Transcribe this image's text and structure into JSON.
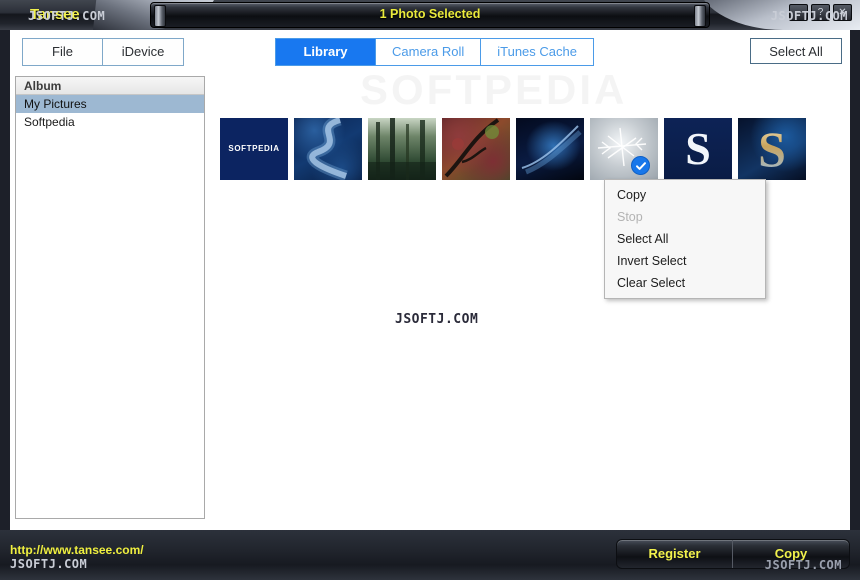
{
  "window": {
    "logo_text": "Tansee",
    "title": "1 Photo Selected",
    "controls": [
      {
        "name": "minimize",
        "glyph": "–"
      },
      {
        "name": "help",
        "glyph": "?"
      },
      {
        "name": "close",
        "glyph": "✕"
      }
    ]
  },
  "watermarks": {
    "top_left": "JSOFTJ.COM",
    "top_right": "JSOFTJ.COM",
    "center": "JSOFTJ.COM",
    "bottom_left": "JSOFTJ.COM",
    "bottom_right": "JSOFTJ.COM",
    "softpedia": "SOFTPEDIA"
  },
  "toolbar": {
    "menu_buttons": [
      {
        "label": "File"
      },
      {
        "label": "iDevice"
      }
    ],
    "tabs": [
      {
        "label": "Library",
        "active": true
      },
      {
        "label": "Camera Roll",
        "active": false
      },
      {
        "label": "iTunes Cache",
        "active": false
      }
    ],
    "select_all_label": "Select All"
  },
  "sidebar": {
    "header": "Album",
    "items": [
      {
        "label": "My Pictures",
        "selected": true
      },
      {
        "label": "Softpedia",
        "selected": false
      }
    ]
  },
  "gallery": {
    "thumbnails": [
      {
        "name": "softpedia-logo",
        "selected": false,
        "caption": "SOFTPEDIA"
      },
      {
        "name": "blue-river-s",
        "selected": false,
        "caption": ""
      },
      {
        "name": "misty-forest",
        "selected": false,
        "caption": ""
      },
      {
        "name": "autumn-leaves",
        "selected": false,
        "caption": ""
      },
      {
        "name": "blue-abstract",
        "selected": false,
        "caption": ""
      },
      {
        "name": "frost-crystal",
        "selected": true,
        "caption": ""
      },
      {
        "name": "letter-s-navy",
        "selected": false,
        "caption": "S"
      },
      {
        "name": "letter-s-gold",
        "selected": false,
        "caption": "S"
      }
    ]
  },
  "context_menu": {
    "items": [
      {
        "label": "Copy",
        "disabled": false
      },
      {
        "label": "Stop",
        "disabled": true
      },
      {
        "label": "Select All",
        "disabled": false
      },
      {
        "label": "Invert Select",
        "disabled": false
      },
      {
        "label": "Clear Select",
        "disabled": false
      }
    ]
  },
  "footer": {
    "link": "http://www.tansee.com/",
    "buttons": [
      {
        "label": "Register"
      },
      {
        "label": "Copy"
      }
    ]
  },
  "colors": {
    "accent_blue": "#1878f0",
    "tab_blue": "#4b9be8",
    "yellow": "#f2f24c",
    "sidebar_selection": "#9db8d2",
    "chrome_dark": "#1d2029"
  }
}
